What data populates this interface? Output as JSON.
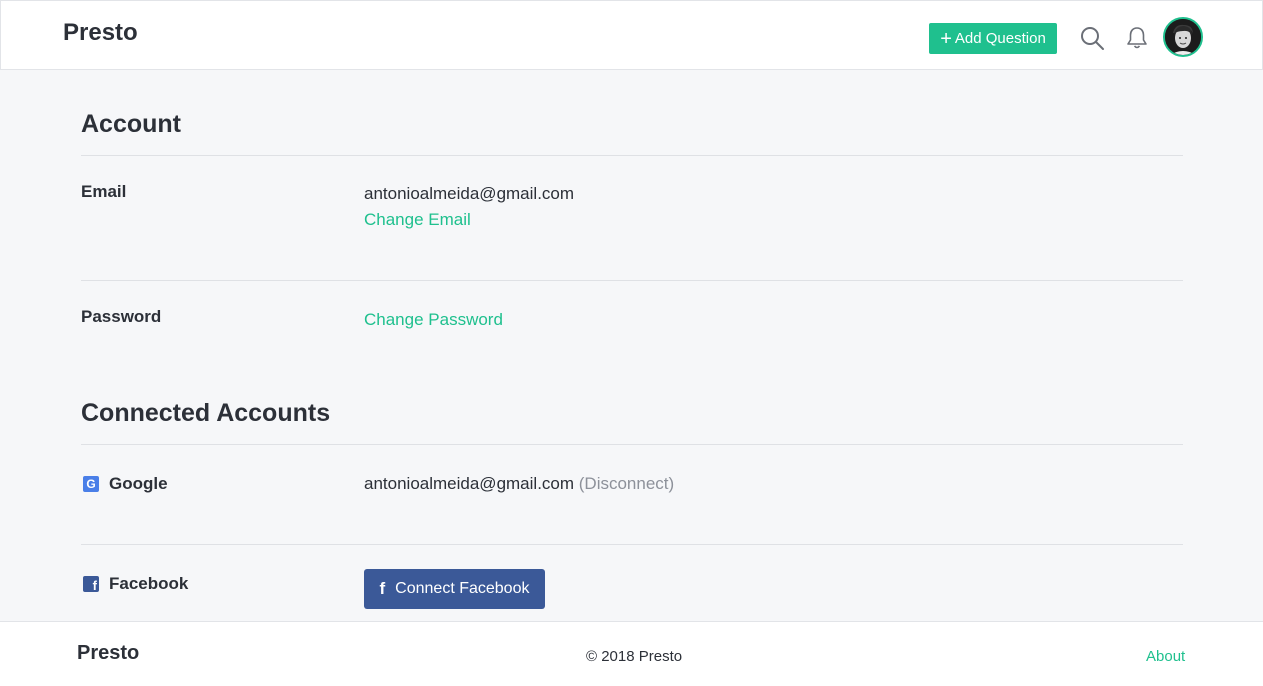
{
  "header": {
    "logo": "Presto",
    "add_question_label": "Add Question",
    "add_question_plus": "+",
    "icons": [
      "search-icon",
      "bell-icon"
    ]
  },
  "account": {
    "title": "Account",
    "email": {
      "label": "Email",
      "value": "antonioalmeida@gmail.com",
      "change_link": "Change Email"
    },
    "password": {
      "label": "Password",
      "change_link": "Change Password"
    }
  },
  "connected": {
    "title": "Connected Accounts",
    "google": {
      "icon_letter": "G",
      "label": "Google",
      "value": "antonioalmeida@gmail.com",
      "disconnect": "(Disconnect)"
    },
    "facebook": {
      "icon_letter": "f",
      "label": "Facebook",
      "button_glyph": "f",
      "button_label": "Connect Facebook"
    }
  },
  "footer": {
    "logo": "Presto",
    "copyright": "© 2018 Presto",
    "about": "About"
  },
  "colors": {
    "accent": "#1fc08e",
    "facebook": "#3b5998",
    "google": "#4a7fe8",
    "background": "#f6f7f9"
  }
}
